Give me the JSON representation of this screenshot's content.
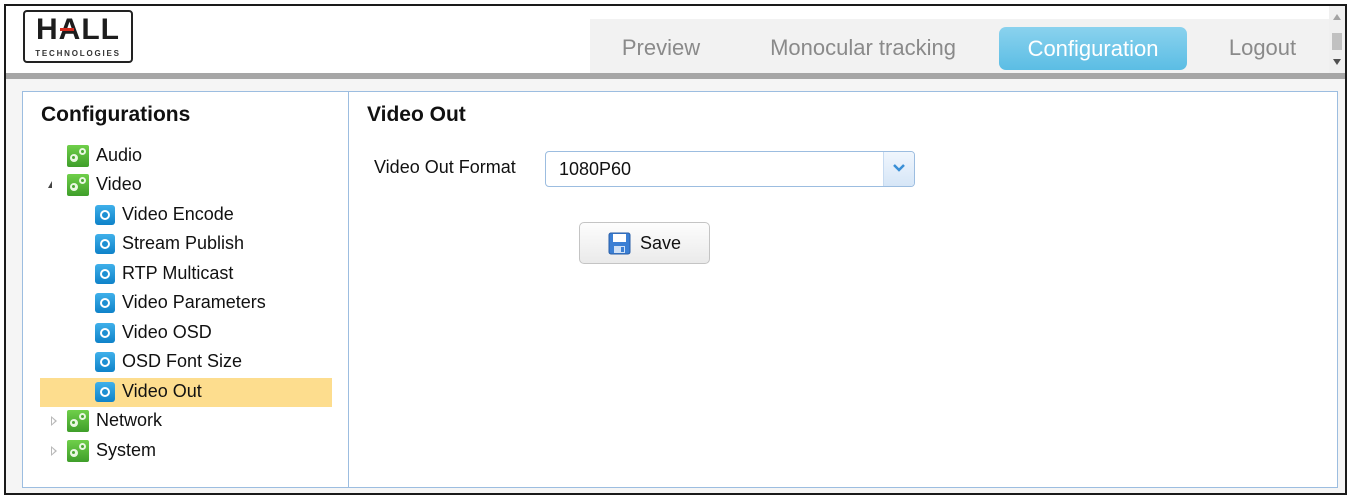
{
  "header": {
    "logo_text": "HALL",
    "logo_subtext": "TECHNOLOGIES",
    "nav": {
      "preview": "Preview",
      "monocular": "Monocular tracking",
      "configuration": "Configuration",
      "logout": "Logout"
    },
    "active_color": "#5bbde4"
  },
  "sidebar": {
    "title": "Configurations",
    "items": {
      "audio": "Audio",
      "video": "Video",
      "video_encode": "Video Encode",
      "stream_publish": "Stream Publish",
      "rtp_multicast": "RTP Multicast",
      "video_parameters": "Video Parameters",
      "video_osd": "Video OSD",
      "osd_font_size": "OSD Font Size",
      "video_out": "Video Out",
      "network": "Network",
      "system": "System"
    },
    "selected": "video_out",
    "selected_color": "#fddd8e",
    "icons": {
      "group": "green-gear-icon",
      "leaf": "blue-settings-icon"
    }
  },
  "main": {
    "title": "Video Out",
    "field_label": "Video Out Format",
    "format_value": "1080P60",
    "save_label": "Save"
  }
}
